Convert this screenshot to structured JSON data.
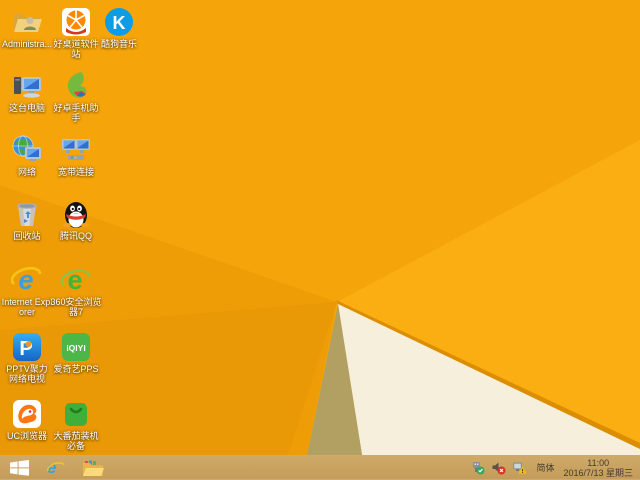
{
  "desktop": {
    "icons": [
      {
        "id": "administrator",
        "label": "Administra..."
      },
      {
        "id": "haozhuodao",
        "label": "好桌道软件站"
      },
      {
        "id": "kugou",
        "label": "酷狗音乐",
        "glyph": "K"
      },
      {
        "id": "this-pc",
        "label": "这台电脑"
      },
      {
        "id": "haozhuo-assistant",
        "label": "好卓手机助手"
      },
      {
        "id": "network",
        "label": "网络"
      },
      {
        "id": "broadband",
        "label": "宽带连接"
      },
      {
        "id": "recycle-bin",
        "label": "回收站"
      },
      {
        "id": "qq",
        "label": "腾讯QQ"
      },
      {
        "id": "internet-explorer",
        "label": "Internet Explorer",
        "glyph": "e"
      },
      {
        "id": "360-browser",
        "label": "360安全浏览器7",
        "glyph": "e"
      },
      {
        "id": "pptv",
        "label": "PPTV聚力 网络电视",
        "glyph": "P"
      },
      {
        "id": "iqiyi",
        "label": "爱奇艺PPS",
        "glyph": "iQIYI"
      },
      {
        "id": "uc-browser",
        "label": "UC浏览器"
      },
      {
        "id": "tomato",
        "label": "大番茄装机必备"
      }
    ]
  },
  "taskbar": {
    "ie_glyph": "e",
    "tray": {
      "ime": "简体",
      "time": "11:00",
      "date": "2016/7/13 星期三"
    }
  },
  "colors": {
    "wallpaper_orange": "#f5a40a",
    "wallpaper_orange_bright": "#fbae12",
    "wallpaper_fold_edge": "#dc8e02",
    "wallpaper_cream": "#f6efdc",
    "wallpaper_tan": "#b2a063",
    "taskbar_tan": "#c9a261",
    "icon_label_text": "#ffffff",
    "taskbar_text": "#423c2d"
  }
}
